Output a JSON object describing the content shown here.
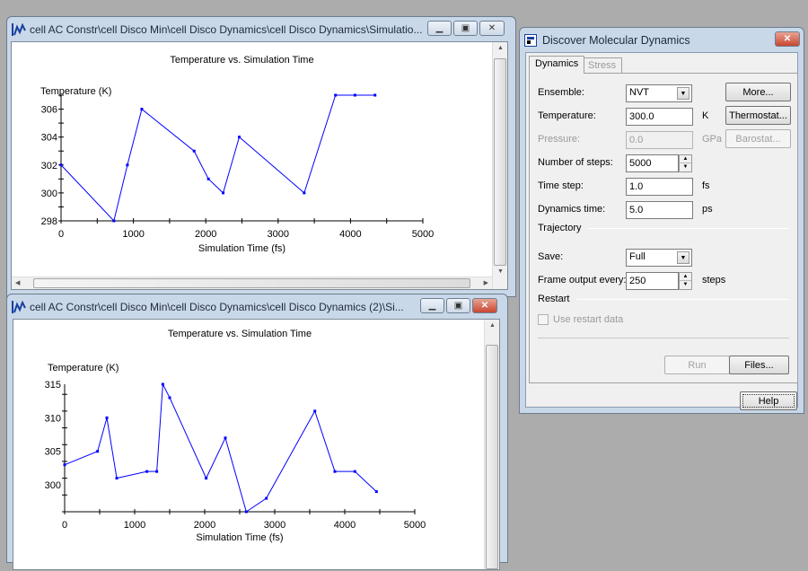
{
  "windows": [
    {
      "title": "cell AC Constr\\cell Disco Min\\cell Disco Dynamics\\cell Disco Dynamics\\Simulatio...",
      "chart_data": {
        "type": "line",
        "title": "Temperature vs. Simulation Time",
        "xlabel": "Simulation Time (fs)",
        "ylabel": "Temperature (K)",
        "xlim": [
          0,
          5000
        ],
        "ylim": [
          298,
          307
        ],
        "xticks": [
          0,
          1000,
          2000,
          3000,
          4000,
          5000
        ],
        "yticks": [
          298,
          300,
          302,
          304,
          306
        ],
        "series_color": "#0000ff",
        "x": [
          0,
          730,
          917,
          1116,
          1839,
          2037,
          2240,
          2463,
          3360,
          3793,
          4062,
          4339
        ],
        "y": [
          302,
          298,
          302,
          306,
          303,
          301,
          300,
          304,
          300,
          307,
          307,
          307
        ]
      }
    },
    {
      "title": "cell AC Constr\\cell Disco Min\\cell Disco Dynamics\\cell Disco Dynamics (2)\\Si...",
      "chart_data": {
        "type": "line",
        "title": "Temperature vs. Simulation Time",
        "xlabel": "Simulation Time (fs)",
        "ylabel": "Temperature (K)",
        "xlim": [
          0,
          5000
        ],
        "ylim": [
          296,
          315
        ],
        "xticks": [
          0,
          1000,
          2000,
          3000,
          4000,
          5000
        ],
        "yticks": [
          300,
          305,
          310,
          315
        ],
        "series_color": "#0000ff",
        "x": [
          0,
          470,
          603,
          744,
          1175,
          1316,
          1402,
          1500,
          2021,
          2295,
          2594,
          2880,
          3573,
          3859,
          4145,
          4453
        ],
        "y": [
          303,
          305,
          310,
          301,
          302,
          302,
          315,
          313,
          301,
          307,
          296,
          298,
          311,
          302,
          302,
          299
        ]
      }
    }
  ],
  "dialog": {
    "title": "Discover Molecular Dynamics",
    "tabs": [
      "Dynamics",
      "Stress"
    ],
    "ensemble": {
      "label": "Ensemble:",
      "value": "NVT"
    },
    "temperature": {
      "label": "Temperature:",
      "value": "300.0",
      "unit": "K"
    },
    "pressure": {
      "label": "Pressure:",
      "value": "0.0",
      "unit": "GPa"
    },
    "steps": {
      "label": "Number of steps:",
      "value": "5000"
    },
    "timestep": {
      "label": "Time step:",
      "value": "1.0",
      "unit": "fs"
    },
    "dyntime": {
      "label": "Dynamics time:",
      "value": "5.0",
      "unit": "ps"
    },
    "trajectory": "Trajectory",
    "save": {
      "label": "Save:",
      "value": "Full"
    },
    "frame": {
      "label": "Frame output every:",
      "value": "250",
      "unit": "steps"
    },
    "restart": "Restart",
    "use_restart": "Use restart data",
    "buttons": {
      "more": "More...",
      "thermostat": "Thermostat...",
      "barostat": "Barostat...",
      "run": "Run",
      "files": "Files...",
      "help": "Help"
    }
  }
}
